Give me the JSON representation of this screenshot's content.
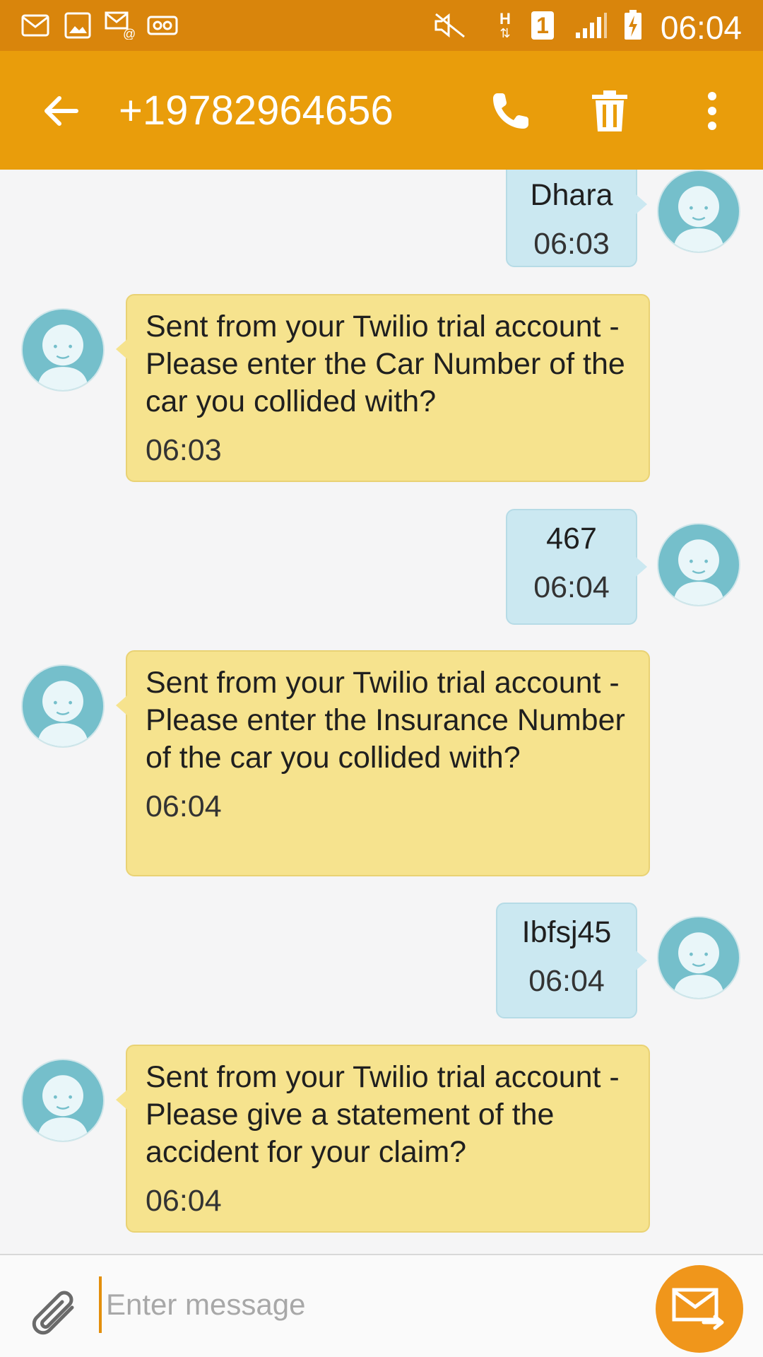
{
  "status_bar": {
    "time": "06:04",
    "network_label": "H",
    "sim_label": "1",
    "left_icons": [
      "gmail-icon",
      "gallery-icon",
      "email-icon",
      "voicemail-icon"
    ],
    "right_icons": [
      "mute-icon",
      "network-h-icon",
      "sim1-icon",
      "signal-icon",
      "battery-charging-icon"
    ]
  },
  "app_bar": {
    "title": "+19782964656",
    "back_icon": "back-arrow-icon",
    "call_icon": "call-icon",
    "delete_icon": "trash-icon",
    "more_icon": "more-vert-icon"
  },
  "messages": [
    {
      "direction": "outgoing",
      "text": "Dhara",
      "time": "06:03"
    },
    {
      "direction": "incoming",
      "text": "Sent from your Twilio trial account - Please enter the Car Number of the car you collided with?",
      "time": "06:03"
    },
    {
      "direction": "outgoing",
      "text": "467",
      "time": "06:04"
    },
    {
      "direction": "incoming",
      "text": "Sent from your Twilio trial account - Please enter the Insurance Number of the car you collided with?",
      "time": "06:04"
    },
    {
      "direction": "outgoing",
      "text": "Ibfsj45",
      "time": "06:04"
    },
    {
      "direction": "incoming",
      "text": "Sent from your Twilio trial account - Please give a statement of the accident for your claim?",
      "time": "06:04"
    }
  ],
  "composer": {
    "placeholder": "Enter message",
    "value": "",
    "attach_icon": "paperclip-icon",
    "send_icon": "send-icon"
  },
  "colors": {
    "status_bar": "#d9850c",
    "app_bar": "#e99d0b",
    "incoming_bubble": "#f6e38e",
    "outgoing_bubble": "#cbe8f1",
    "avatar": "#75bfcb",
    "send_button": "#f0961b"
  }
}
